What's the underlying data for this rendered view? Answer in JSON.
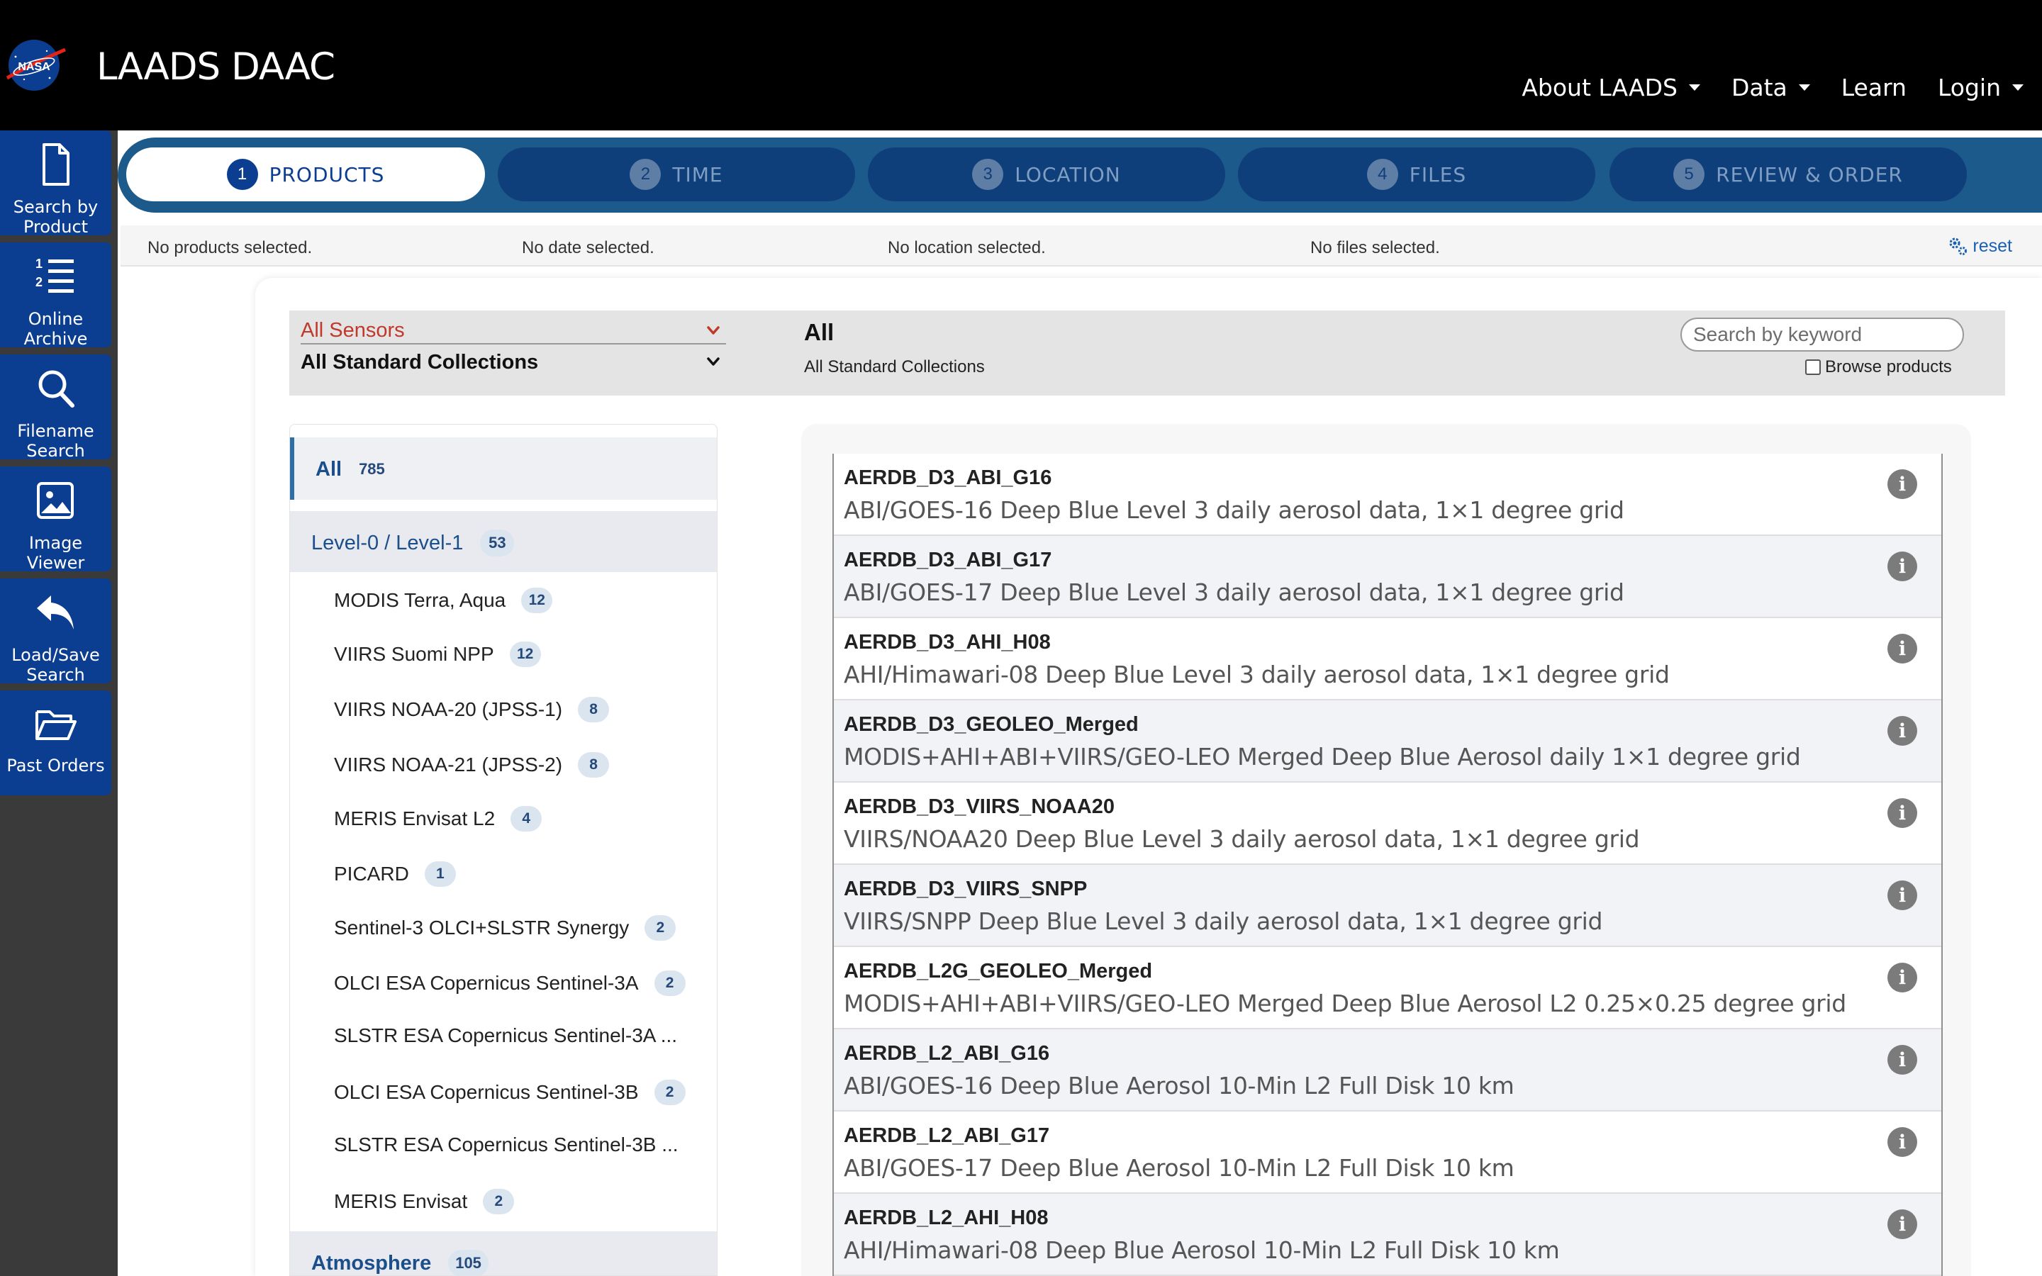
{
  "header": {
    "app_title": "LAADS DAAC",
    "logo_text": "NASA",
    "nav": [
      {
        "label": "About LAADS",
        "dropdown": true
      },
      {
        "label": "Data",
        "dropdown": true
      },
      {
        "label": "Learn",
        "dropdown": false
      },
      {
        "label": "Login",
        "dropdown": true
      }
    ]
  },
  "sidebar": {
    "items": [
      {
        "label_line1": "Search by",
        "label_line2": "Product",
        "icon": "document-icon"
      },
      {
        "label_line1": "Online",
        "label_line2": "Archive",
        "icon": "numbered-list-icon"
      },
      {
        "label_line1": "Filename",
        "label_line2": "Search",
        "icon": "magnifier-icon"
      },
      {
        "label_line1": "Image",
        "label_line2": "Viewer",
        "icon": "image-icon"
      },
      {
        "label_line1": "Load/Save",
        "label_line2": "Search",
        "icon": "reply-arrow-icon"
      },
      {
        "label_line1": "Past Orders",
        "label_line2": "",
        "icon": "folder-open-icon"
      }
    ]
  },
  "steps": [
    {
      "num": "1",
      "label": "PRODUCTS",
      "active": true
    },
    {
      "num": "2",
      "label": "TIME",
      "active": false
    },
    {
      "num": "3",
      "label": "LOCATION",
      "active": false
    },
    {
      "num": "4",
      "label": "FILES",
      "active": false
    },
    {
      "num": "5",
      "label": "REVIEW & ORDER",
      "active": false
    }
  ],
  "summary": {
    "products": "No products selected.",
    "date": "No date selected.",
    "location": "No location selected.",
    "files": "No files selected.",
    "reset_label": "reset"
  },
  "filters": {
    "sensor": "All Sensors",
    "collection": "All Standard Collections",
    "title": "All",
    "subtitle": "All Standard Collections",
    "search_placeholder": "Search by keyword",
    "browse_label": "Browse products"
  },
  "categories": {
    "all": {
      "label": "All",
      "count": "785"
    },
    "level01": {
      "label": "Level-0 / Level-1",
      "count": "53"
    },
    "subitems": [
      {
        "label": "MODIS Terra, Aqua",
        "count": "12"
      },
      {
        "label": "VIIRS Suomi NPP",
        "count": "12"
      },
      {
        "label": "VIIRS NOAA-20 (JPSS-1)",
        "count": "8"
      },
      {
        "label": "VIIRS NOAA-21 (JPSS-2)",
        "count": "8"
      },
      {
        "label": "MERIS Envisat L2",
        "count": "4"
      },
      {
        "label": "PICARD",
        "count": "1"
      },
      {
        "label": "Sentinel-3 OLCI+SLSTR Synergy",
        "count": "2"
      },
      {
        "label": "OLCI ESA Copernicus Sentinel-3A",
        "count": "2"
      },
      {
        "label": "SLSTR ESA Copernicus Sentinel-3A ...",
        "count": ""
      },
      {
        "label": "OLCI ESA Copernicus Sentinel-3B",
        "count": "2"
      },
      {
        "label": "SLSTR ESA Copernicus Sentinel-3B ...",
        "count": ""
      },
      {
        "label": "MERIS Envisat",
        "count": "2"
      }
    ],
    "atmosphere": {
      "label": "Atmosphere",
      "count": "105"
    }
  },
  "products": [
    {
      "name": "AERDB_D3_ABI_G16",
      "desc": "ABI/GOES-16 Deep Blue Level 3 daily aerosol data, 1×1 degree grid"
    },
    {
      "name": "AERDB_D3_ABI_G17",
      "desc": "ABI/GOES-17 Deep Blue Level 3 daily aerosol data, 1×1 degree grid"
    },
    {
      "name": "AERDB_D3_AHI_H08",
      "desc": "AHI/Himawari-08 Deep Blue Level 3 daily aerosol data, 1×1 degree grid"
    },
    {
      "name": "AERDB_D3_GEOLEO_Merged",
      "desc": "MODIS+AHI+ABI+VIIRS/GEO-LEO Merged Deep Blue Aerosol daily 1×1 degree grid"
    },
    {
      "name": "AERDB_D3_VIIRS_NOAA20",
      "desc": "VIIRS/NOAA20 Deep Blue Level 3 daily aerosol data, 1×1 degree grid"
    },
    {
      "name": "AERDB_D3_VIIRS_SNPP",
      "desc": "VIIRS/SNPP Deep Blue Level 3 daily aerosol data, 1×1 degree grid"
    },
    {
      "name": "AERDB_L2G_GEOLEO_Merged",
      "desc": "MODIS+AHI+ABI+VIIRS/GEO-LEO Merged Deep Blue Aerosol L2 0.25×0.25 degree grid"
    },
    {
      "name": "AERDB_L2_ABI_G16",
      "desc": "ABI/GOES-16 Deep Blue Aerosol 10-Min L2 Full Disk 10 km"
    },
    {
      "name": "AERDB_L2_ABI_G17",
      "desc": "ABI/GOES-17 Deep Blue Aerosol 10-Min L2 Full Disk 10 km"
    },
    {
      "name": "AERDB_L2_AHI_H08",
      "desc": "AHI/Himawari-08 Deep Blue Aerosol 10-Min L2 Full Disk 10 km"
    }
  ],
  "colors": {
    "nasa_blue": "#0b3d91",
    "step_bar": "#1b5a8a",
    "sensor_red": "#c0392b",
    "link_blue": "#1a5fb4"
  }
}
